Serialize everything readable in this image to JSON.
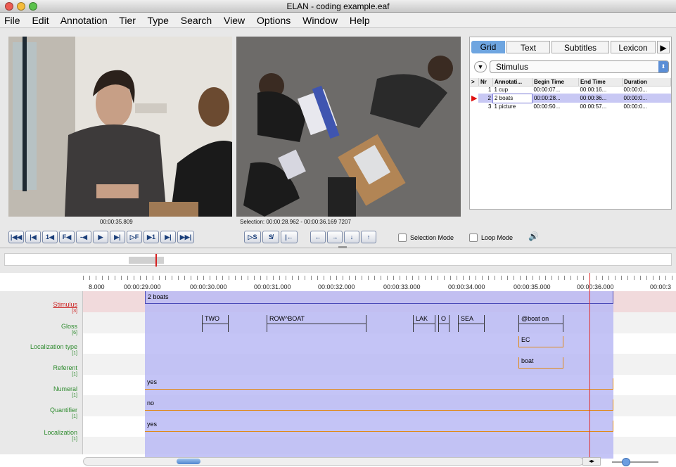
{
  "window": {
    "title": "ELAN - coding example.eaf"
  },
  "menu": [
    "File",
    "Edit",
    "Annotation",
    "Tier",
    "Type",
    "Search",
    "View",
    "Options",
    "Window",
    "Help"
  ],
  "video": {
    "timecode_left": "00:00:35.809",
    "selection": "Selection: 00:00:28.962 - 00:00:36.169  7207"
  },
  "controls": {
    "player_buttons": [
      "|◀◀",
      "|◀",
      "1◀",
      "F◀",
      "-◀",
      "▶",
      "▶|",
      "▷F",
      "▶1",
      "▶|",
      "▶▶|"
    ],
    "selection_buttons": [
      "▷S",
      "S̸",
      "|←"
    ],
    "arrow_buttons": [
      "←",
      "→",
      "↓",
      "↑"
    ],
    "selection_mode": "Selection Mode",
    "loop_mode": "Loop Mode"
  },
  "right_panel": {
    "tabs": [
      "Grid",
      "Text",
      "Subtitles",
      "Lexicon"
    ],
    "tier_select": "Stimulus",
    "columns": [
      ">",
      "Nr",
      "Annotati...",
      "Begin Time",
      "End Time",
      "Duration"
    ],
    "rows": [
      {
        "nr": "1",
        "annotation": "1 cup",
        "begin": "00:00:07...",
        "end": "00:00:16...",
        "duration": "00:00:0..."
      },
      {
        "nr": "2",
        "annotation": "2 boats",
        "begin": "00:00:28...",
        "end": "00:00:36...",
        "duration": "00:00:0..."
      },
      {
        "nr": "3",
        "annotation": "1 picture",
        "begin": "00:00:50...",
        "end": "00:00:57...",
        "duration": "00:00:0..."
      }
    ]
  },
  "timeline": {
    "ticks": [
      "8.000",
      "00:00:29.000",
      "00:00:30.000",
      "00:00:31.000",
      "00:00:32.000",
      "00:00:33.000",
      "00:00:34.000",
      "00:00:35.000",
      "00:00:36.000",
      "00:00:3"
    ],
    "tiers": [
      {
        "name": "Stimulus",
        "count": "[3]"
      },
      {
        "name": "Gloss",
        "count": "[6]"
      },
      {
        "name": "Localization type",
        "count": "[1]"
      },
      {
        "name": "Referent",
        "count": "[1]"
      },
      {
        "name": "Numeral",
        "count": "[1]"
      },
      {
        "name": "Quantifier",
        "count": "[1]"
      },
      {
        "name": "Localization",
        "count": "[1]"
      }
    ],
    "annotations": {
      "stimulus": "2 boats",
      "gloss": [
        "TWO",
        "ROW^BOAT",
        "LAK",
        "O",
        "SEA",
        "@boat on"
      ],
      "loc_type": "EC",
      "referent": "boat",
      "numeral": "yes",
      "quantifier": "no",
      "localization": "yes"
    }
  }
}
